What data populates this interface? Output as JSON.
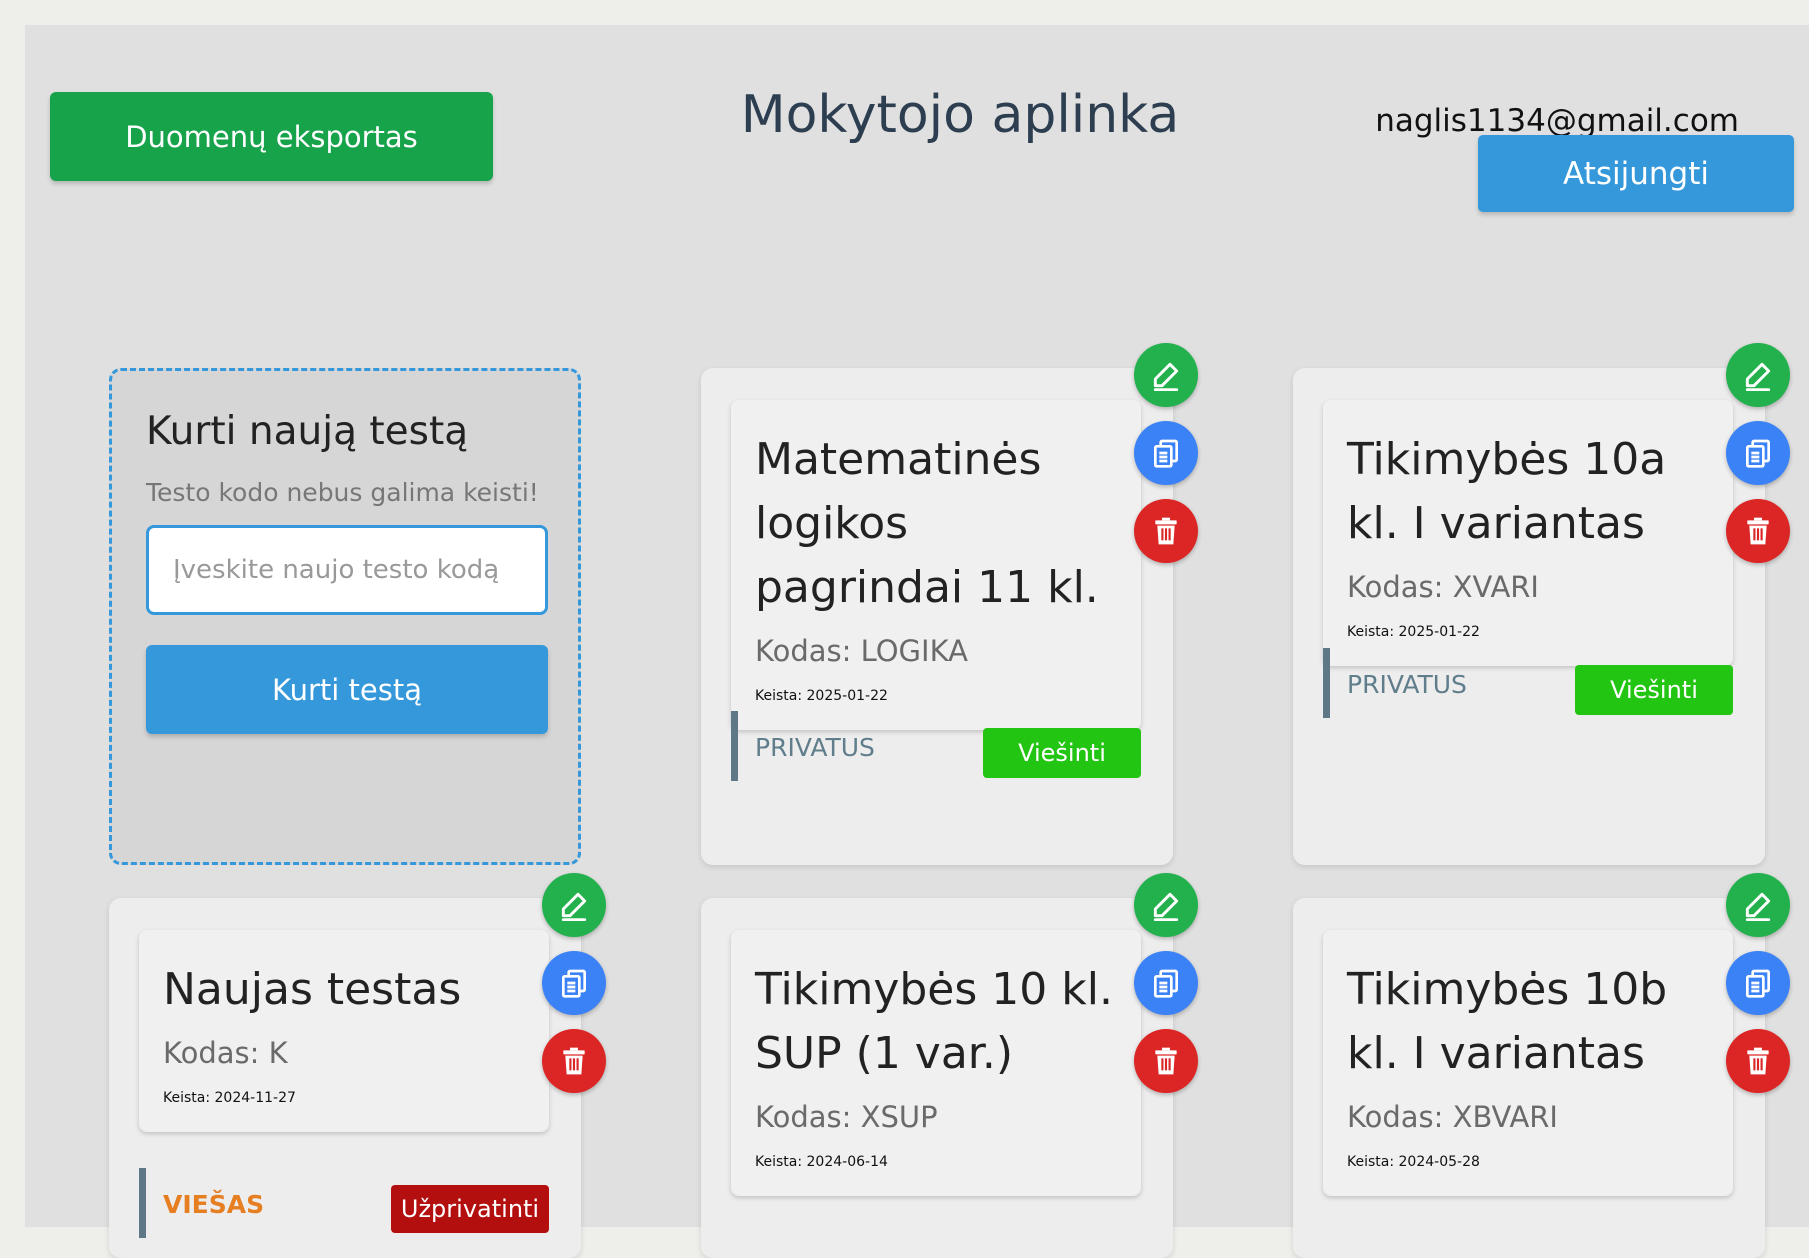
{
  "header": {
    "export_label": "Duomenų eksportas",
    "title": "Mokytojo aplinka",
    "user_email": "naglis1134@gmail.com",
    "logout_label": "Atsijungti"
  },
  "create": {
    "title": "Kurti naują testą",
    "hint": "Testo kodo nebus galima keisti!",
    "placeholder": "Įveskite naujo testo kodą",
    "button_label": "Kurti testą"
  },
  "tests": [
    {
      "title": "Matematinės logikos pagrindai 11 kl.",
      "code": "Kodas: LOGIKA",
      "modified": "Keista: 2025-01-22",
      "status": "PRIVATUS",
      "action_label": "Viešinti"
    },
    {
      "title": "Tikimybės 10a kl. I variantas",
      "code": "Kodas: XVARI",
      "modified": "Keista: 2025-01-22",
      "status": "PRIVATUS",
      "action_label": "Viešinti"
    },
    {
      "title": "Naujas testas",
      "code": "Kodas: K",
      "modified": "Keista: 2024-11-27",
      "status": "VIEŠAS",
      "action_label": "Užprivatinti"
    },
    {
      "title": "Tikimybės 10 kl. SUP (1 var.)",
      "code": "Kodas: XSUP",
      "modified": "Keista: 2024-06-14"
    },
    {
      "title": "Tikimybės 10b kl. I variantas",
      "code": "Kodas: XBVARI",
      "modified": "Keista: 2024-05-28"
    }
  ],
  "icons": {
    "edit": "pencil-icon",
    "copy": "copy-icon",
    "delete": "trash-icon"
  },
  "colors": {
    "export": "#16a34a",
    "primary": "#3498db",
    "publish": "#22c511",
    "unpublish": "#b40f0f",
    "edit": "#22b14c",
    "copy": "#3b82f6",
    "delete": "#dc2626"
  }
}
